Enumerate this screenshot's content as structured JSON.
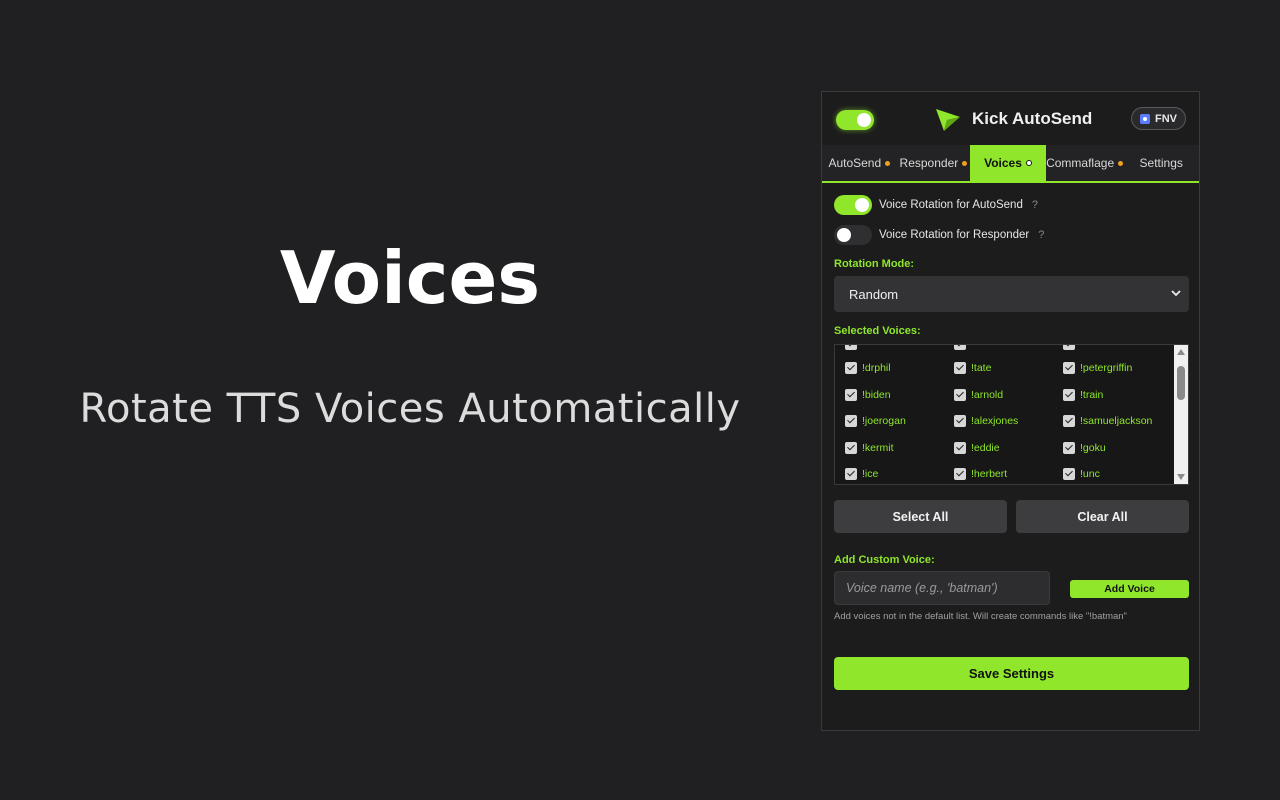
{
  "hero": {
    "title": "Voices",
    "subtitle": "Rotate TTS Voices Automatically"
  },
  "header": {
    "app_title": "Kick AutoSend",
    "user_badge": "FNV",
    "master_enabled": true,
    "logo_icon": "paper-plane-icon"
  },
  "tabs": [
    {
      "label": "AutoSend",
      "active": false
    },
    {
      "label": "Responder",
      "active": false
    },
    {
      "label": "Voices",
      "active": true
    },
    {
      "label": "Commaflage",
      "active": false
    },
    {
      "label": "Settings",
      "active": false
    }
  ],
  "toggles": {
    "autosend": {
      "label": "Voice Rotation for AutoSend",
      "on": true,
      "help": "?"
    },
    "responder": {
      "label": "Voice Rotation for Responder",
      "on": false,
      "help": "?"
    }
  },
  "rotation": {
    "label": "Rotation Mode:",
    "selected": "Random"
  },
  "voices": {
    "label": "Selected Voices:",
    "rows": [
      [
        "!drphil",
        "!tate",
        "!petergriffin"
      ],
      [
        "!biden",
        "!arnold",
        "!train"
      ],
      [
        "!joerogan",
        "!alexjones",
        "!samueljackson"
      ],
      [
        "!kermit",
        "!eddie",
        "!goku"
      ],
      [
        "!ice",
        "!herbert",
        "!unc"
      ]
    ],
    "select_all": "Select All",
    "clear_all": "Clear All"
  },
  "custom": {
    "label": "Add Custom Voice:",
    "placeholder": "Voice name (e.g., 'batman')",
    "button": "Add Voice",
    "hint": "Add voices not in the default list. Will create commands like \"!batman\""
  },
  "save": {
    "label": "Save Settings"
  },
  "colors": {
    "accent": "#8fe62a",
    "background": "#202022",
    "panel": "#1c1c1d"
  }
}
